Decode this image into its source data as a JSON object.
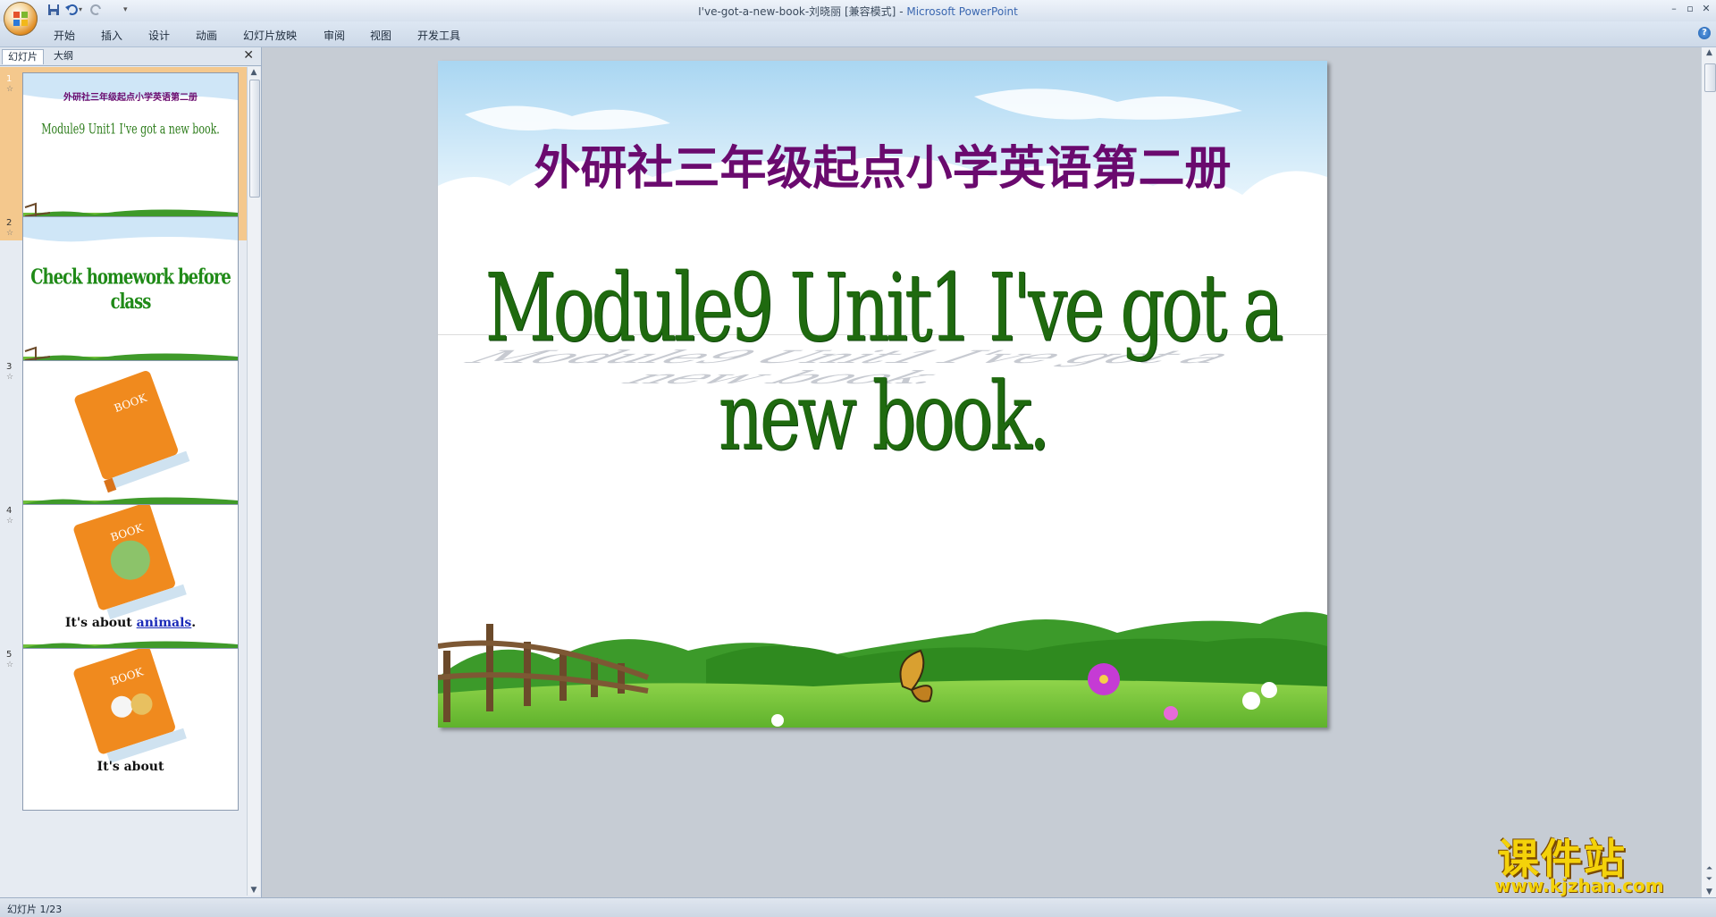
{
  "window": {
    "title_file": "I've-got-a-new-book-刘晓丽 [兼容模式]",
    "title_sep": " - ",
    "title_app": "Microsoft PowerPoint"
  },
  "ribbon": {
    "tabs": [
      "开始",
      "插入",
      "设计",
      "动画",
      "幻灯片放映",
      "审阅",
      "视图",
      "开发工具"
    ]
  },
  "panel": {
    "tab_slides": "幻灯片",
    "tab_outline": "大纲",
    "close": "✕",
    "slides": [
      {
        "num": "1",
        "title": "外研社三年级起点小学英语第二册",
        "subtitle": "Module9 Unit1  I've got a new book."
      },
      {
        "num": "2",
        "title": "Check homework before class"
      },
      {
        "num": "3",
        "book_label": "BOOK"
      },
      {
        "num": "4",
        "book_label": "BOOK",
        "caption_prefix": "It's about ",
        "caption_link": "animals",
        "caption_suffix": "."
      },
      {
        "num": "5",
        "book_label": "BOOK",
        "caption_prefix": "It's about "
      }
    ]
  },
  "slide": {
    "cn_title": "外研社三年级起点小学英语第二册",
    "en_title": "Module9 Unit1  I've got a new book."
  },
  "status": {
    "slide_counter": "幻灯片 1/23"
  },
  "watermark": {
    "cn": "课件站",
    "url": "www.kjzhan.com"
  },
  "colors": {
    "cn_title": "#6a0a6e",
    "en_title": "#1f6a0f",
    "link": "#1a2ab8",
    "selected_thumb": "#f4c88d"
  }
}
